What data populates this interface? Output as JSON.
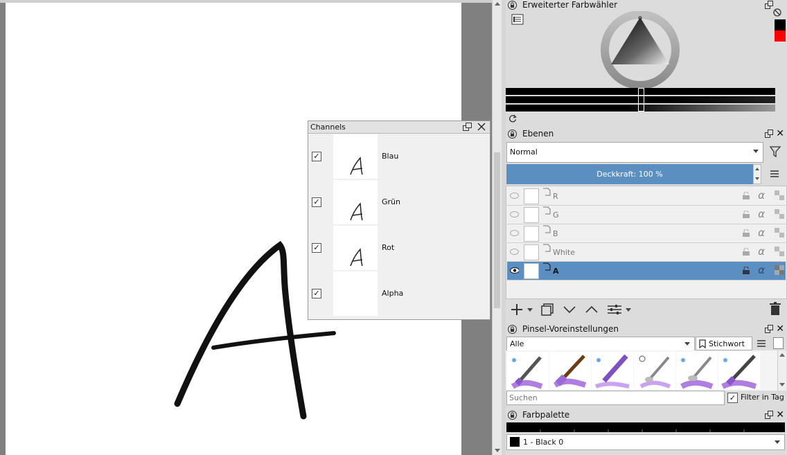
{
  "channels": {
    "title": "Channels",
    "items": [
      {
        "label": "Blau",
        "checked": true,
        "has_glyph": true
      },
      {
        "label": "Grün",
        "checked": true,
        "has_glyph": true
      },
      {
        "label": "Rot",
        "checked": true,
        "has_glyph": true
      },
      {
        "label": "Alpha",
        "checked": true,
        "has_glyph": false
      }
    ]
  },
  "color_selector": {
    "title": "Erweiterter Farbwähler",
    "fg_color": "#000000",
    "bg_color": "#ff0000"
  },
  "layers": {
    "title": "Ebenen",
    "blend_mode": "Normal",
    "opacity_label": "Deckkraft:  100 %",
    "opacity_percent": 100,
    "accent": "#5b8fc2",
    "items": [
      {
        "name": "R",
        "visible": false,
        "selected": false
      },
      {
        "name": "G",
        "visible": false,
        "selected": false
      },
      {
        "name": "B",
        "visible": false,
        "selected": false
      },
      {
        "name": "White",
        "visible": false,
        "selected": false
      },
      {
        "name": "A",
        "visible": true,
        "selected": true
      }
    ]
  },
  "brush_presets": {
    "title": "Pinsel-Voreinstellungen",
    "filter_value": "Alle",
    "tag_button": "Stichwort",
    "search_placeholder": "Suchen",
    "filter_in_tag_label": "Filter in Tag",
    "filter_in_tag_checked": true
  },
  "palette": {
    "title": "Farbpalette",
    "selected_color_label": "1 - Black 0",
    "selected_color": "#000000"
  }
}
